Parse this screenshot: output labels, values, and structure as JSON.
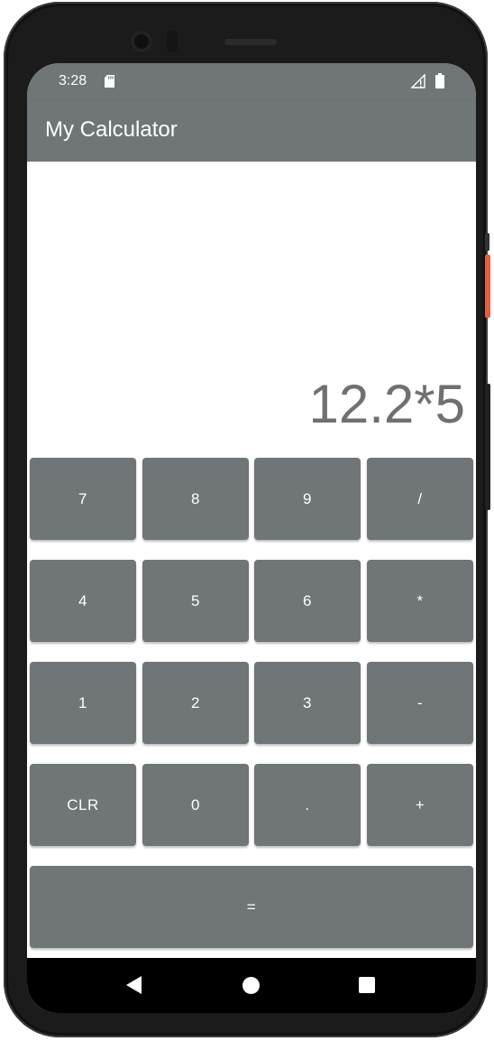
{
  "status_bar": {
    "time": "3:28",
    "icons": [
      "sd-card-icon",
      "signal-icon",
      "battery-icon"
    ]
  },
  "app_bar": {
    "title": "My Calculator"
  },
  "display": {
    "expression": "12.2*5"
  },
  "keypad": {
    "row1": [
      "7",
      "8",
      "9",
      "/"
    ],
    "row2": [
      "4",
      "5",
      "6",
      "*"
    ],
    "row3": [
      "1",
      "2",
      "3",
      "-"
    ],
    "row4": [
      "CLR",
      "0",
      ".",
      "+"
    ],
    "equals": "="
  },
  "nav_bar": {
    "icons": [
      "back-icon",
      "home-icon",
      "recents-icon"
    ]
  },
  "colors": {
    "app_bar": "#707577",
    "button": "#707577",
    "display_text": "#707070",
    "screen_bg": "#ffffff"
  }
}
